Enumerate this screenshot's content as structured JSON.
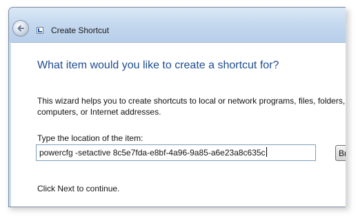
{
  "window": {
    "title": "Create Shortcut",
    "icon": "shortcut-wizard-icon"
  },
  "nav": {
    "back_icon": "back-arrow-icon"
  },
  "main": {
    "heading": "What item would you like to create a shortcut for?",
    "description": "This wizard helps you to create shortcuts to local or network programs, files, folders, computers, or Internet addresses.",
    "location_label": "Type the location of the item:",
    "location_value": "powercfg -setactive 8c5e7fda-e8bf-4a96-9a85-a6e23a8c635c",
    "browse_label": "Browse...",
    "hint": "Click Next to continue."
  },
  "colors": {
    "heading": "#1f4d8f",
    "titlebar": "#c5d9ef"
  }
}
